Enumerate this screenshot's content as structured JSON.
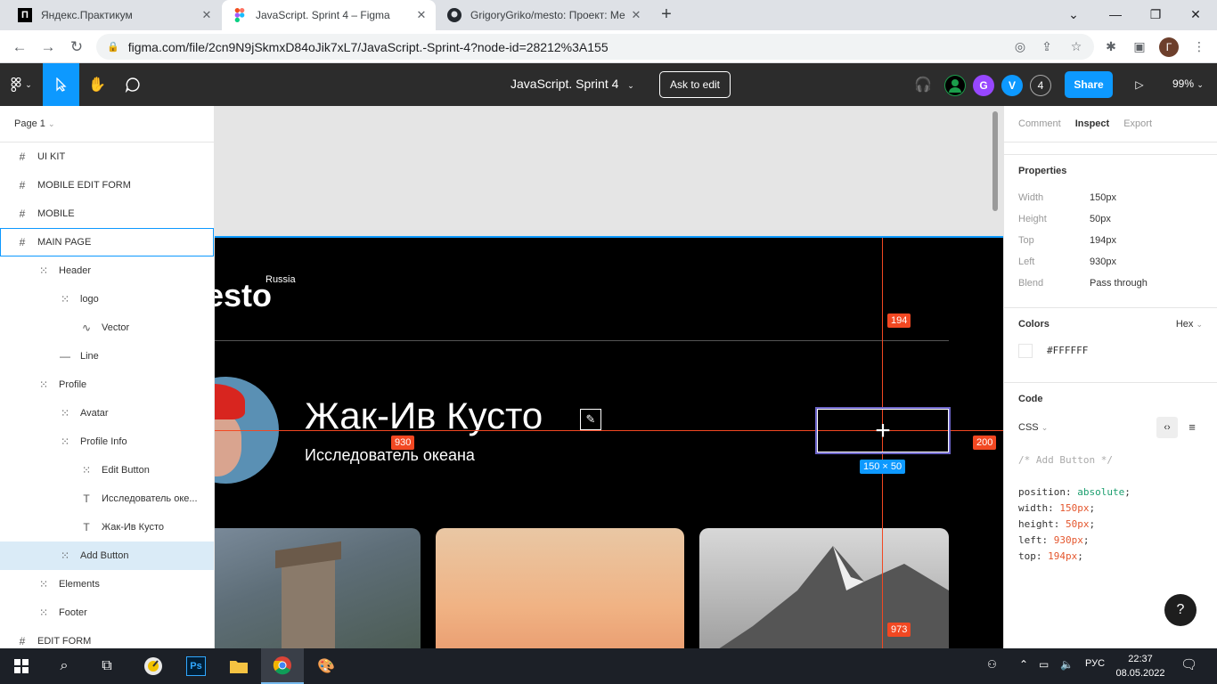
{
  "browser": {
    "tabs": [
      {
        "title": "Яндекс.Практикум",
        "active": false
      },
      {
        "title": "JavaScript. Sprint 4 – Figma",
        "active": true
      },
      {
        "title": "GrigoryGriko/mesto: Проект: Ме",
        "active": false
      }
    ],
    "url": "figma.com/file/2cn9N9jSkmxD84oJik7xL7/JavaScript.-Sprint-4?node-id=28212%3A155",
    "profile_initial": "Г"
  },
  "figma": {
    "file_title": "JavaScript. Sprint 4",
    "ask_to_edit": "Ask to edit",
    "users": [
      {
        "initial": "",
        "color": "#1b9e4b"
      },
      {
        "initial": "G",
        "color": "#9747ff"
      },
      {
        "initial": "V",
        "color": "#0d99ff"
      },
      {
        "initial": "4",
        "color": "#2c2c2c"
      }
    ],
    "share": "Share",
    "zoom": "99%"
  },
  "layers": {
    "page": "Page 1",
    "items": [
      {
        "label": "UI KIT",
        "indent": 0,
        "icon": "#"
      },
      {
        "label": "MOBILE EDIT FORM",
        "indent": 0,
        "icon": "#"
      },
      {
        "label": "MOBILE",
        "indent": 0,
        "icon": "#"
      },
      {
        "label": "MAIN PAGE",
        "indent": 0,
        "icon": "#"
      },
      {
        "label": "Header",
        "indent": 1,
        "icon": "⁞"
      },
      {
        "label": "logo",
        "indent": 2,
        "icon": "⁞"
      },
      {
        "label": "Vector",
        "indent": 3,
        "icon": "∿"
      },
      {
        "label": "Line",
        "indent": 2,
        "icon": "—"
      },
      {
        "label": "Profile",
        "indent": 1,
        "icon": "⁞"
      },
      {
        "label": "Avatar",
        "indent": 2,
        "icon": "⁞"
      },
      {
        "label": "Profile Info",
        "indent": 2,
        "icon": "⁞"
      },
      {
        "label": "Edit Button",
        "indent": 3,
        "icon": "⁞"
      },
      {
        "label": "Исследователь оке...",
        "indent": 3,
        "icon": "T"
      },
      {
        "label": "Жак-Ив Кусто",
        "indent": 3,
        "icon": "T"
      },
      {
        "label": "Add Button",
        "indent": 2,
        "icon": "⁞"
      },
      {
        "label": "Elements",
        "indent": 1,
        "icon": "⁞"
      },
      {
        "label": "Footer",
        "indent": 1,
        "icon": "⁞"
      },
      {
        "label": "EDIT FORM",
        "indent": 0,
        "icon": "#"
      }
    ]
  },
  "canvas": {
    "logo_text": "esto",
    "logo_sup": "Russia",
    "profile_name": "Жак-Ив Кусто",
    "profile_job": "Исследователь океана",
    "add_symbol": "+",
    "measure_top": "194",
    "measure_left": "930",
    "measure_right": "200",
    "measure_bottom": "973",
    "size_badge": "150 × 50"
  },
  "inspect": {
    "tabs": [
      "Comment",
      "Inspect",
      "Export"
    ],
    "properties_title": "Properties",
    "properties": [
      {
        "key": "Width",
        "value": "150px"
      },
      {
        "key": "Height",
        "value": "50px"
      },
      {
        "key": "Top",
        "value": "194px"
      },
      {
        "key": "Left",
        "value": "930px"
      },
      {
        "key": "Blend",
        "value": "Pass through"
      }
    ],
    "colors_title": "Colors",
    "color_format": "Hex",
    "color_value": "#FFFFFF",
    "code_title": "Code",
    "code_lang": "CSS",
    "code_comment": "/* Add Button */",
    "code_lines": [
      {
        "prop": "position:",
        "val": "absolute",
        "kind": "kw"
      },
      {
        "prop": "width:",
        "val": "150px",
        "kind": "num"
      },
      {
        "prop": "height:",
        "val": "50px",
        "kind": "num"
      },
      {
        "prop": "left:",
        "val": "930px",
        "kind": "num"
      },
      {
        "prop": "top:",
        "val": "194px",
        "kind": "num"
      }
    ],
    "help": "?"
  },
  "taskbar": {
    "lang": "РУС",
    "time": "22:37",
    "date": "08.05.2022"
  }
}
